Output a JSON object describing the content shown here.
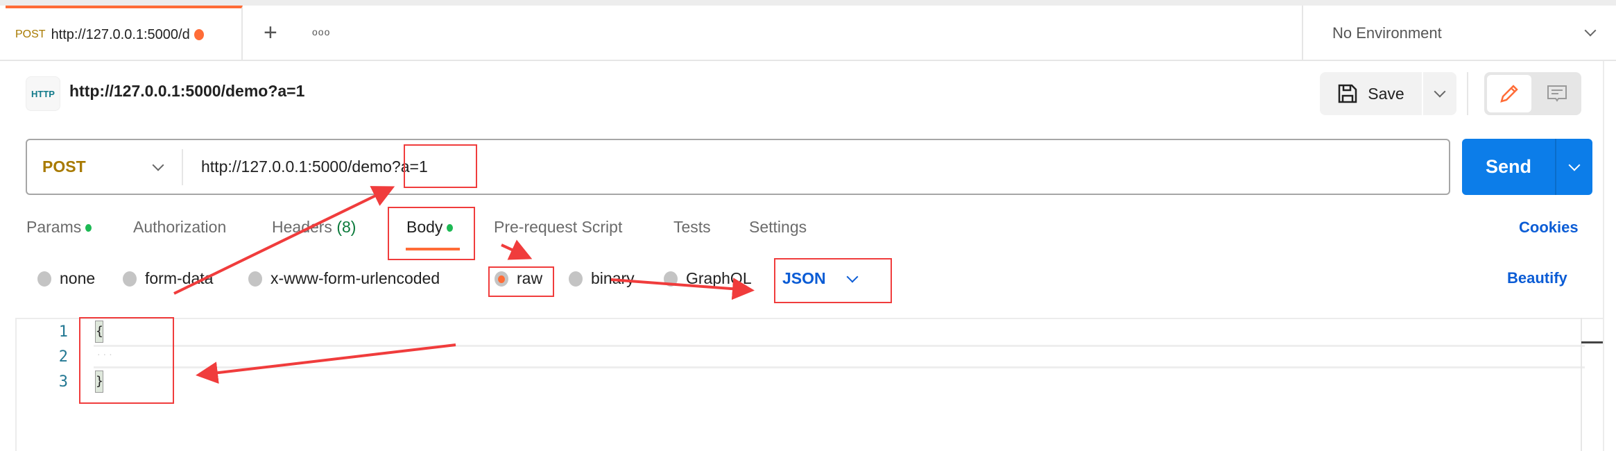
{
  "tab": {
    "method": "POST",
    "url": "http://127.0.0.1:5000/d"
  },
  "environment": "No Environment",
  "request": {
    "title": "http://127.0.0.1:5000/demo?a=1",
    "icon_label": "HTTP",
    "method": "POST",
    "url": "http://127.0.0.1:5000/demo?a=1"
  },
  "buttons": {
    "save": "Save",
    "send": "Send",
    "cookies": "Cookies",
    "beautify": "Beautify"
  },
  "req_tabs": {
    "params": "Params",
    "authorization": "Authorization",
    "headers": "Headers",
    "headers_count": "(8)",
    "body": "Body",
    "prerequest": "Pre-request Script",
    "tests": "Tests",
    "settings": "Settings"
  },
  "body_types": {
    "none": "none",
    "form_data": "form-data",
    "urlencoded": "x-www-form-urlencoded",
    "raw": "raw",
    "binary": "binary",
    "graphql": "GraphQL",
    "format": "JSON"
  },
  "editor": {
    "lines": [
      "1",
      "2",
      "3"
    ],
    "code": [
      "{",
      "· · ·",
      "}"
    ]
  },
  "colors": {
    "accent": "#ff6c37",
    "send": "#0c7de9",
    "link": "#0b5cd5",
    "annotation": "#f03c3c"
  }
}
